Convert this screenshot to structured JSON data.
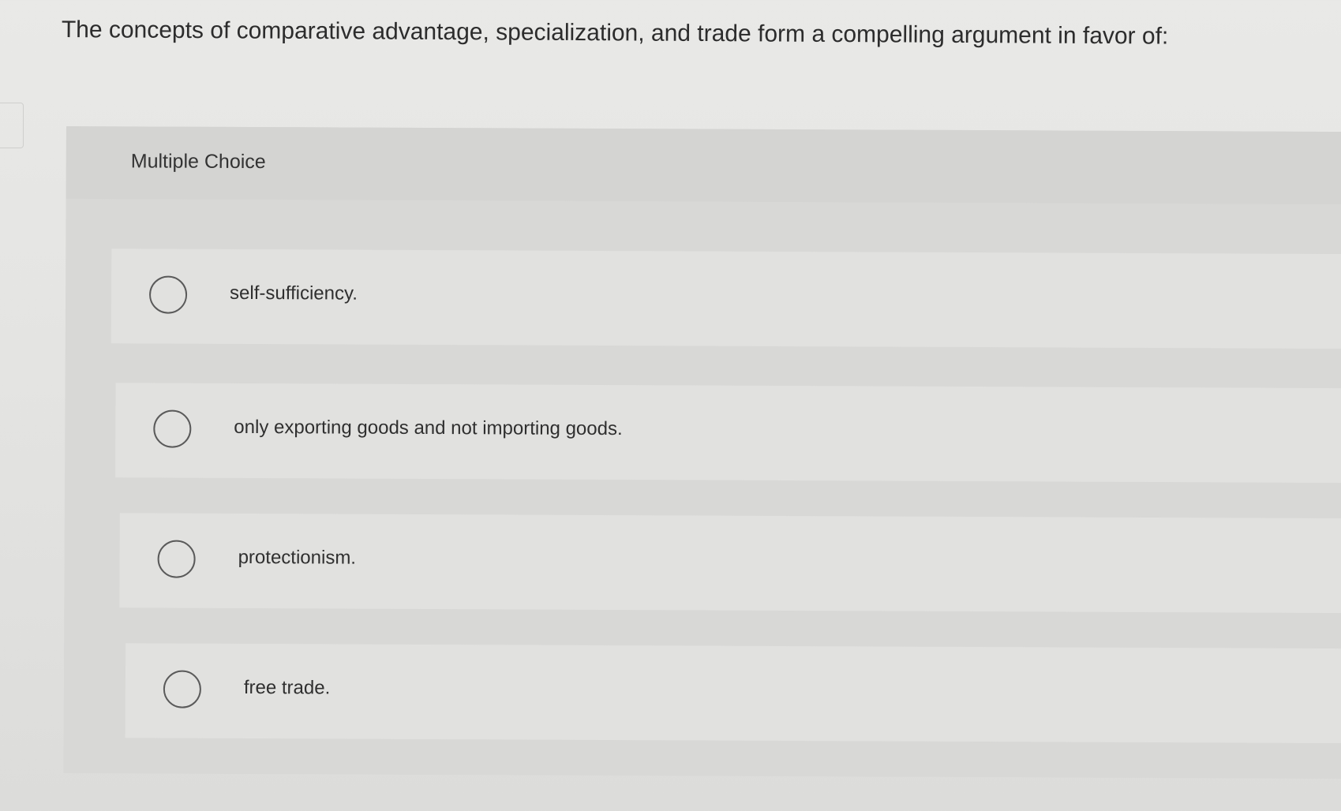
{
  "question": {
    "text": "The concepts of comparative advantage, specialization, and trade form a compelling argument in favor of:"
  },
  "panel": {
    "label": "Multiple Choice"
  },
  "choices": [
    {
      "label": "self-sufficiency."
    },
    {
      "label": "only exporting goods and not importing goods."
    },
    {
      "label": "protectionism."
    },
    {
      "label": "free trade."
    }
  ],
  "colors": {
    "background": "#e6e6e4",
    "panel": "#d8d8d6",
    "choice_row": "#e1e1df",
    "radio_border": "#5a5a5a",
    "text": "#2c2c2c"
  }
}
